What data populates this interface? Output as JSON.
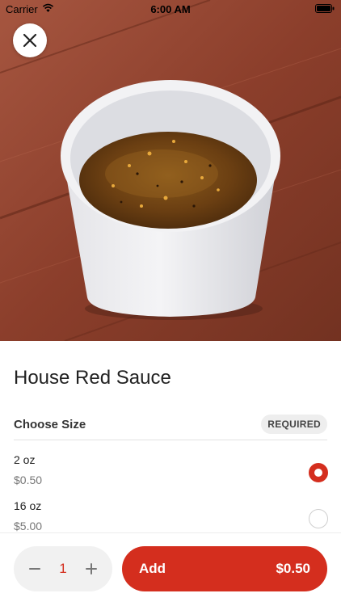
{
  "status_bar": {
    "carrier": "Carrier",
    "time": "6:00 AM"
  },
  "item": {
    "title": "House Red Sauce",
    "image_alt": "sauce-cup-photo"
  },
  "choose_size": {
    "title": "Choose Size",
    "badge": "REQUIRED",
    "options": [
      {
        "name": "2 oz",
        "price": "$0.50",
        "selected": true
      },
      {
        "name": "16 oz",
        "price": "$5.00",
        "selected": false
      }
    ]
  },
  "footer": {
    "quantity": "1",
    "add_label": "Add",
    "add_price": "$0.50"
  },
  "colors": {
    "accent": "#d42e1e",
    "badge_bg": "#eeeeee",
    "stepper_bg": "#f1f1f1"
  },
  "icons": {
    "close": "close-icon",
    "minus": "minus-icon",
    "plus": "plus-icon",
    "wifi": "wifi-icon",
    "battery": "battery-icon"
  }
}
